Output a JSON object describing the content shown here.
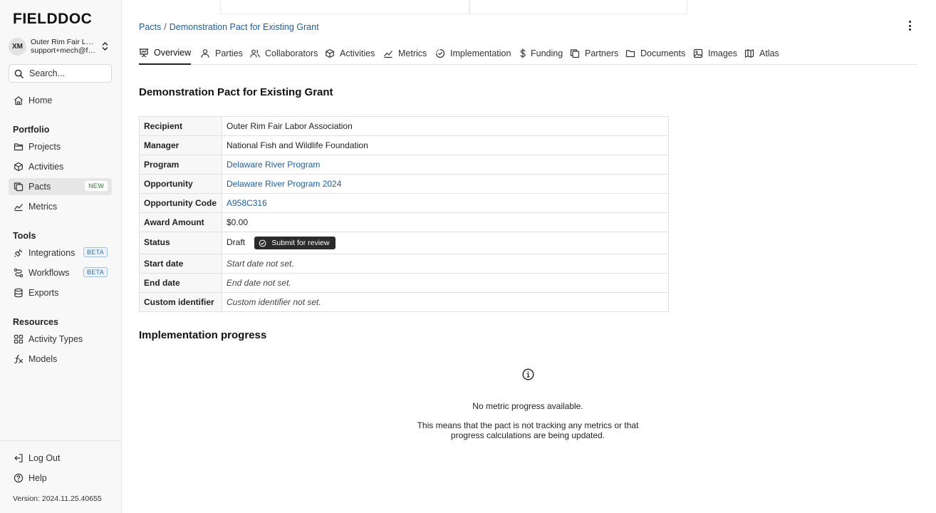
{
  "app": {
    "logo": "FIELDDOC"
  },
  "org": {
    "initials": "XM",
    "name": "Outer Rim Fair Labor Association",
    "email": "support+mech@fielddoc.org"
  },
  "sidebar": {
    "search_label": "Search...",
    "home": "Home",
    "portfolio_title": "Portfolio",
    "portfolio": [
      {
        "label": "Projects",
        "icon": "folder-icon"
      },
      {
        "label": "Activities",
        "icon": "cube-icon"
      },
      {
        "label": "Pacts",
        "icon": "copy-icon",
        "badge": "NEW"
      },
      {
        "label": "Metrics",
        "icon": "trend-icon"
      }
    ],
    "tools_title": "Tools",
    "tools": [
      {
        "label": "Integrations",
        "icon": "plug-icon",
        "badge": "BETA"
      },
      {
        "label": "Workflows",
        "icon": "workflow-icon",
        "badge": "BETA"
      },
      {
        "label": "Exports",
        "icon": "database-icon"
      }
    ],
    "resources_title": "Resources",
    "resources": [
      {
        "label": "Activity Types",
        "icon": "grid-icon"
      },
      {
        "label": "Models",
        "icon": "function-icon"
      }
    ],
    "logout": "Log Out",
    "help": "Help",
    "version": "Version: 2024.11.25.40655"
  },
  "breadcrumb": {
    "root": "Pacts",
    "separator": "/",
    "current": "Demonstration Pact for Existing Grant"
  },
  "tabs": [
    {
      "label": "Overview",
      "icon": "presentation-icon",
      "active": true
    },
    {
      "label": "Parties",
      "icon": "user-icon"
    },
    {
      "label": "Collaborators",
      "icon": "users-icon"
    },
    {
      "label": "Activities",
      "icon": "cube-icon"
    },
    {
      "label": "Metrics",
      "icon": "trend-icon"
    },
    {
      "label": "Implementation",
      "icon": "progress-check-icon"
    },
    {
      "label": "Funding",
      "icon": "dollar-icon"
    },
    {
      "label": "Partners",
      "icon": "copy-icon"
    },
    {
      "label": "Documents",
      "icon": "folder-icon"
    },
    {
      "label": "Images",
      "icon": "image-icon"
    },
    {
      "label": "Atlas",
      "icon": "map-icon"
    }
  ],
  "page": {
    "title": "Demonstration Pact for Existing Grant",
    "details": {
      "recipient": {
        "label": "Recipient",
        "value": "Outer Rim Fair Labor Association"
      },
      "manager": {
        "label": "Manager",
        "value": "National Fish and Wildlife Foundation"
      },
      "program": {
        "label": "Program",
        "value": "Delaware River Program"
      },
      "opportunity": {
        "label": "Opportunity",
        "value": "Delaware River Program 2024"
      },
      "opportunity_code": {
        "label": "Opportunity Code",
        "value": "A958C316"
      },
      "award_amount": {
        "label": "Award Amount",
        "value": "$0.00"
      },
      "status": {
        "label": "Status",
        "value": "Draft",
        "action": "Submit for review"
      },
      "start_date": {
        "label": "Start date",
        "value": "Start date not set."
      },
      "end_date": {
        "label": "End date",
        "value": "End date not set."
      },
      "custom_identifier": {
        "label": "Custom identifier",
        "value": "Custom identifier not set."
      }
    },
    "implementation": {
      "title": "Implementation progress",
      "empty_title": "No metric progress available.",
      "empty_desc": "This means that the pact is not tracking any metrics or that progress calculations are being updated."
    }
  }
}
